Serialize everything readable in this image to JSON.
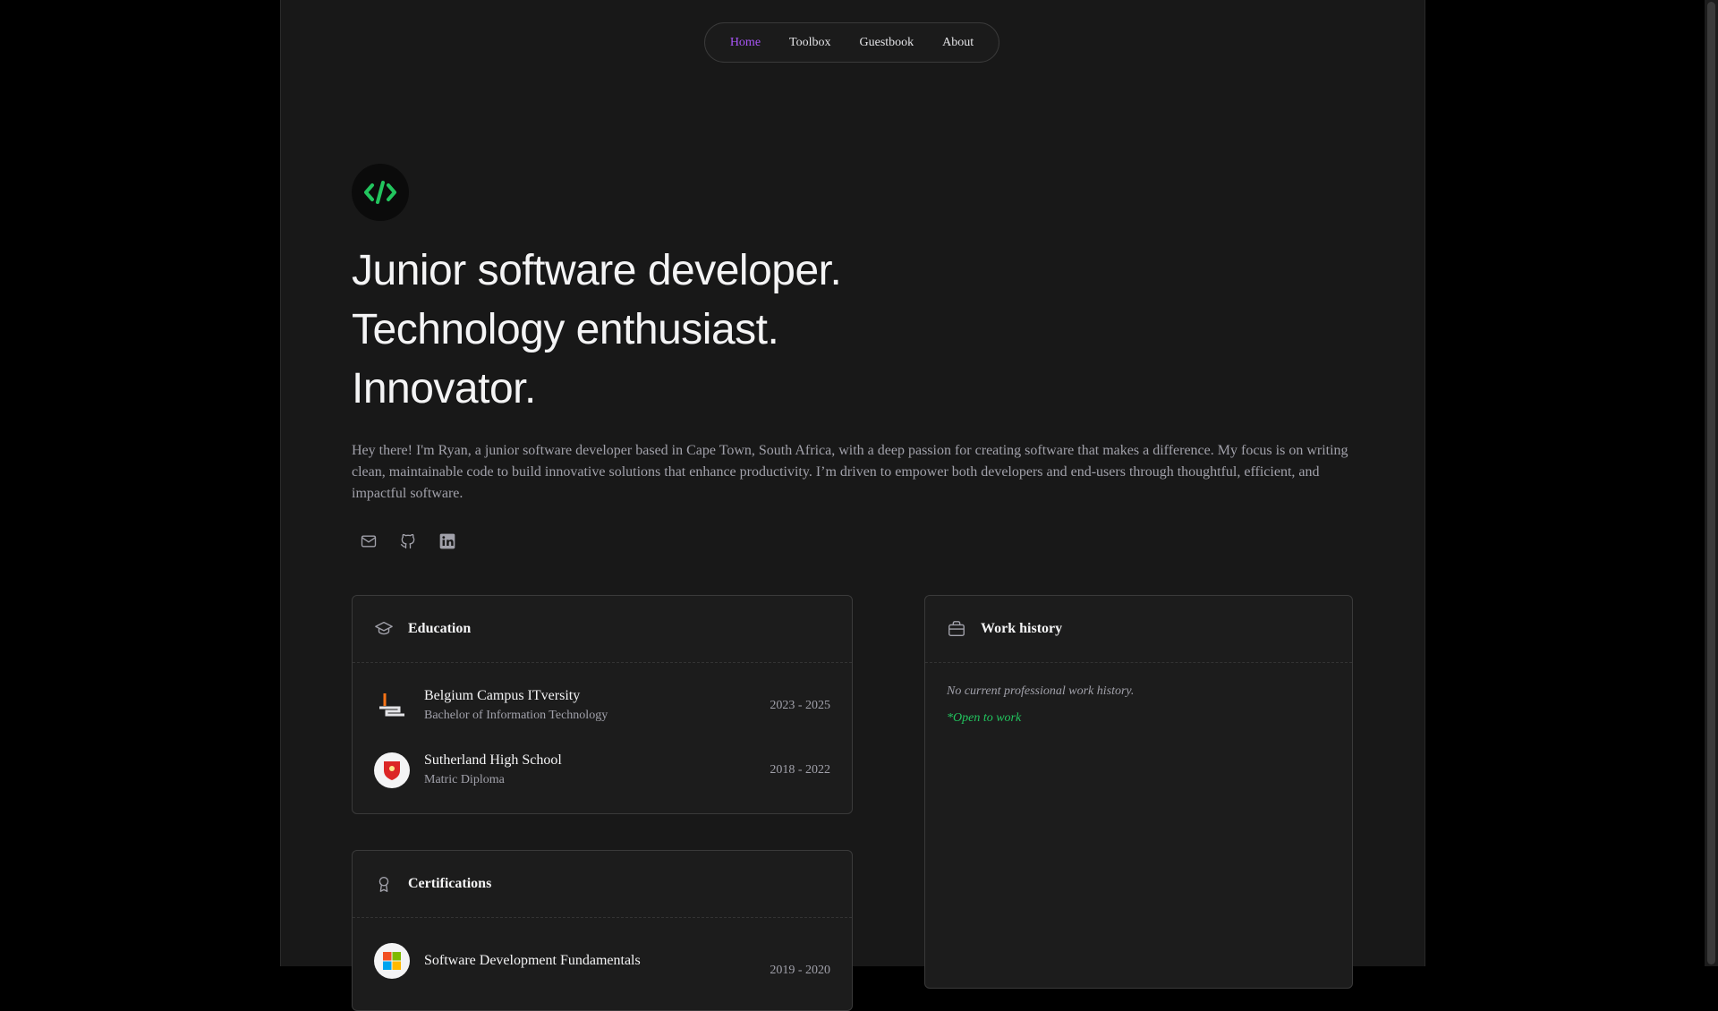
{
  "nav": {
    "items": [
      {
        "label": "Home",
        "active": true
      },
      {
        "label": "Toolbox"
      },
      {
        "label": "Guestbook"
      },
      {
        "label": "About"
      }
    ]
  },
  "logo": {
    "icon": "code-slash-icon",
    "color": "#22c55e"
  },
  "hero": {
    "lines": [
      "Junior software developer.",
      "Technology enthusiast.",
      "Innovator."
    ],
    "intro": "Hey there! I'm Ryan, a junior software developer based in Cape Town, South Africa, with a deep passion for creating software that makes a difference. My focus is on writing clean, maintainable code to build innovative solutions that enhance productivity. I’m driven to empower both developers and end-users through thoughtful, efficient, and impactful software."
  },
  "socials": [
    {
      "icon": "mail-icon"
    },
    {
      "icon": "github-icon"
    },
    {
      "icon": "linkedin-icon"
    }
  ],
  "education": {
    "title": "Education",
    "items": [
      {
        "name": "Belgium Campus ITversity",
        "degree": "Bachelor of Information Technology",
        "dates": "2023 - 2025"
      },
      {
        "name": "Sutherland High School",
        "degree": "Matric Diploma",
        "dates": "2018 - 2022"
      }
    ]
  },
  "certifications": {
    "title": "Certifications",
    "items": [
      {
        "name": "Software Development Fundamentals",
        "dates": "2019 - 2020"
      }
    ]
  },
  "work": {
    "title": "Work history",
    "empty": "No current professional work history.",
    "status": "*Open to work"
  },
  "colors": {
    "accent": "#a855f7",
    "green": "#22c55e"
  }
}
